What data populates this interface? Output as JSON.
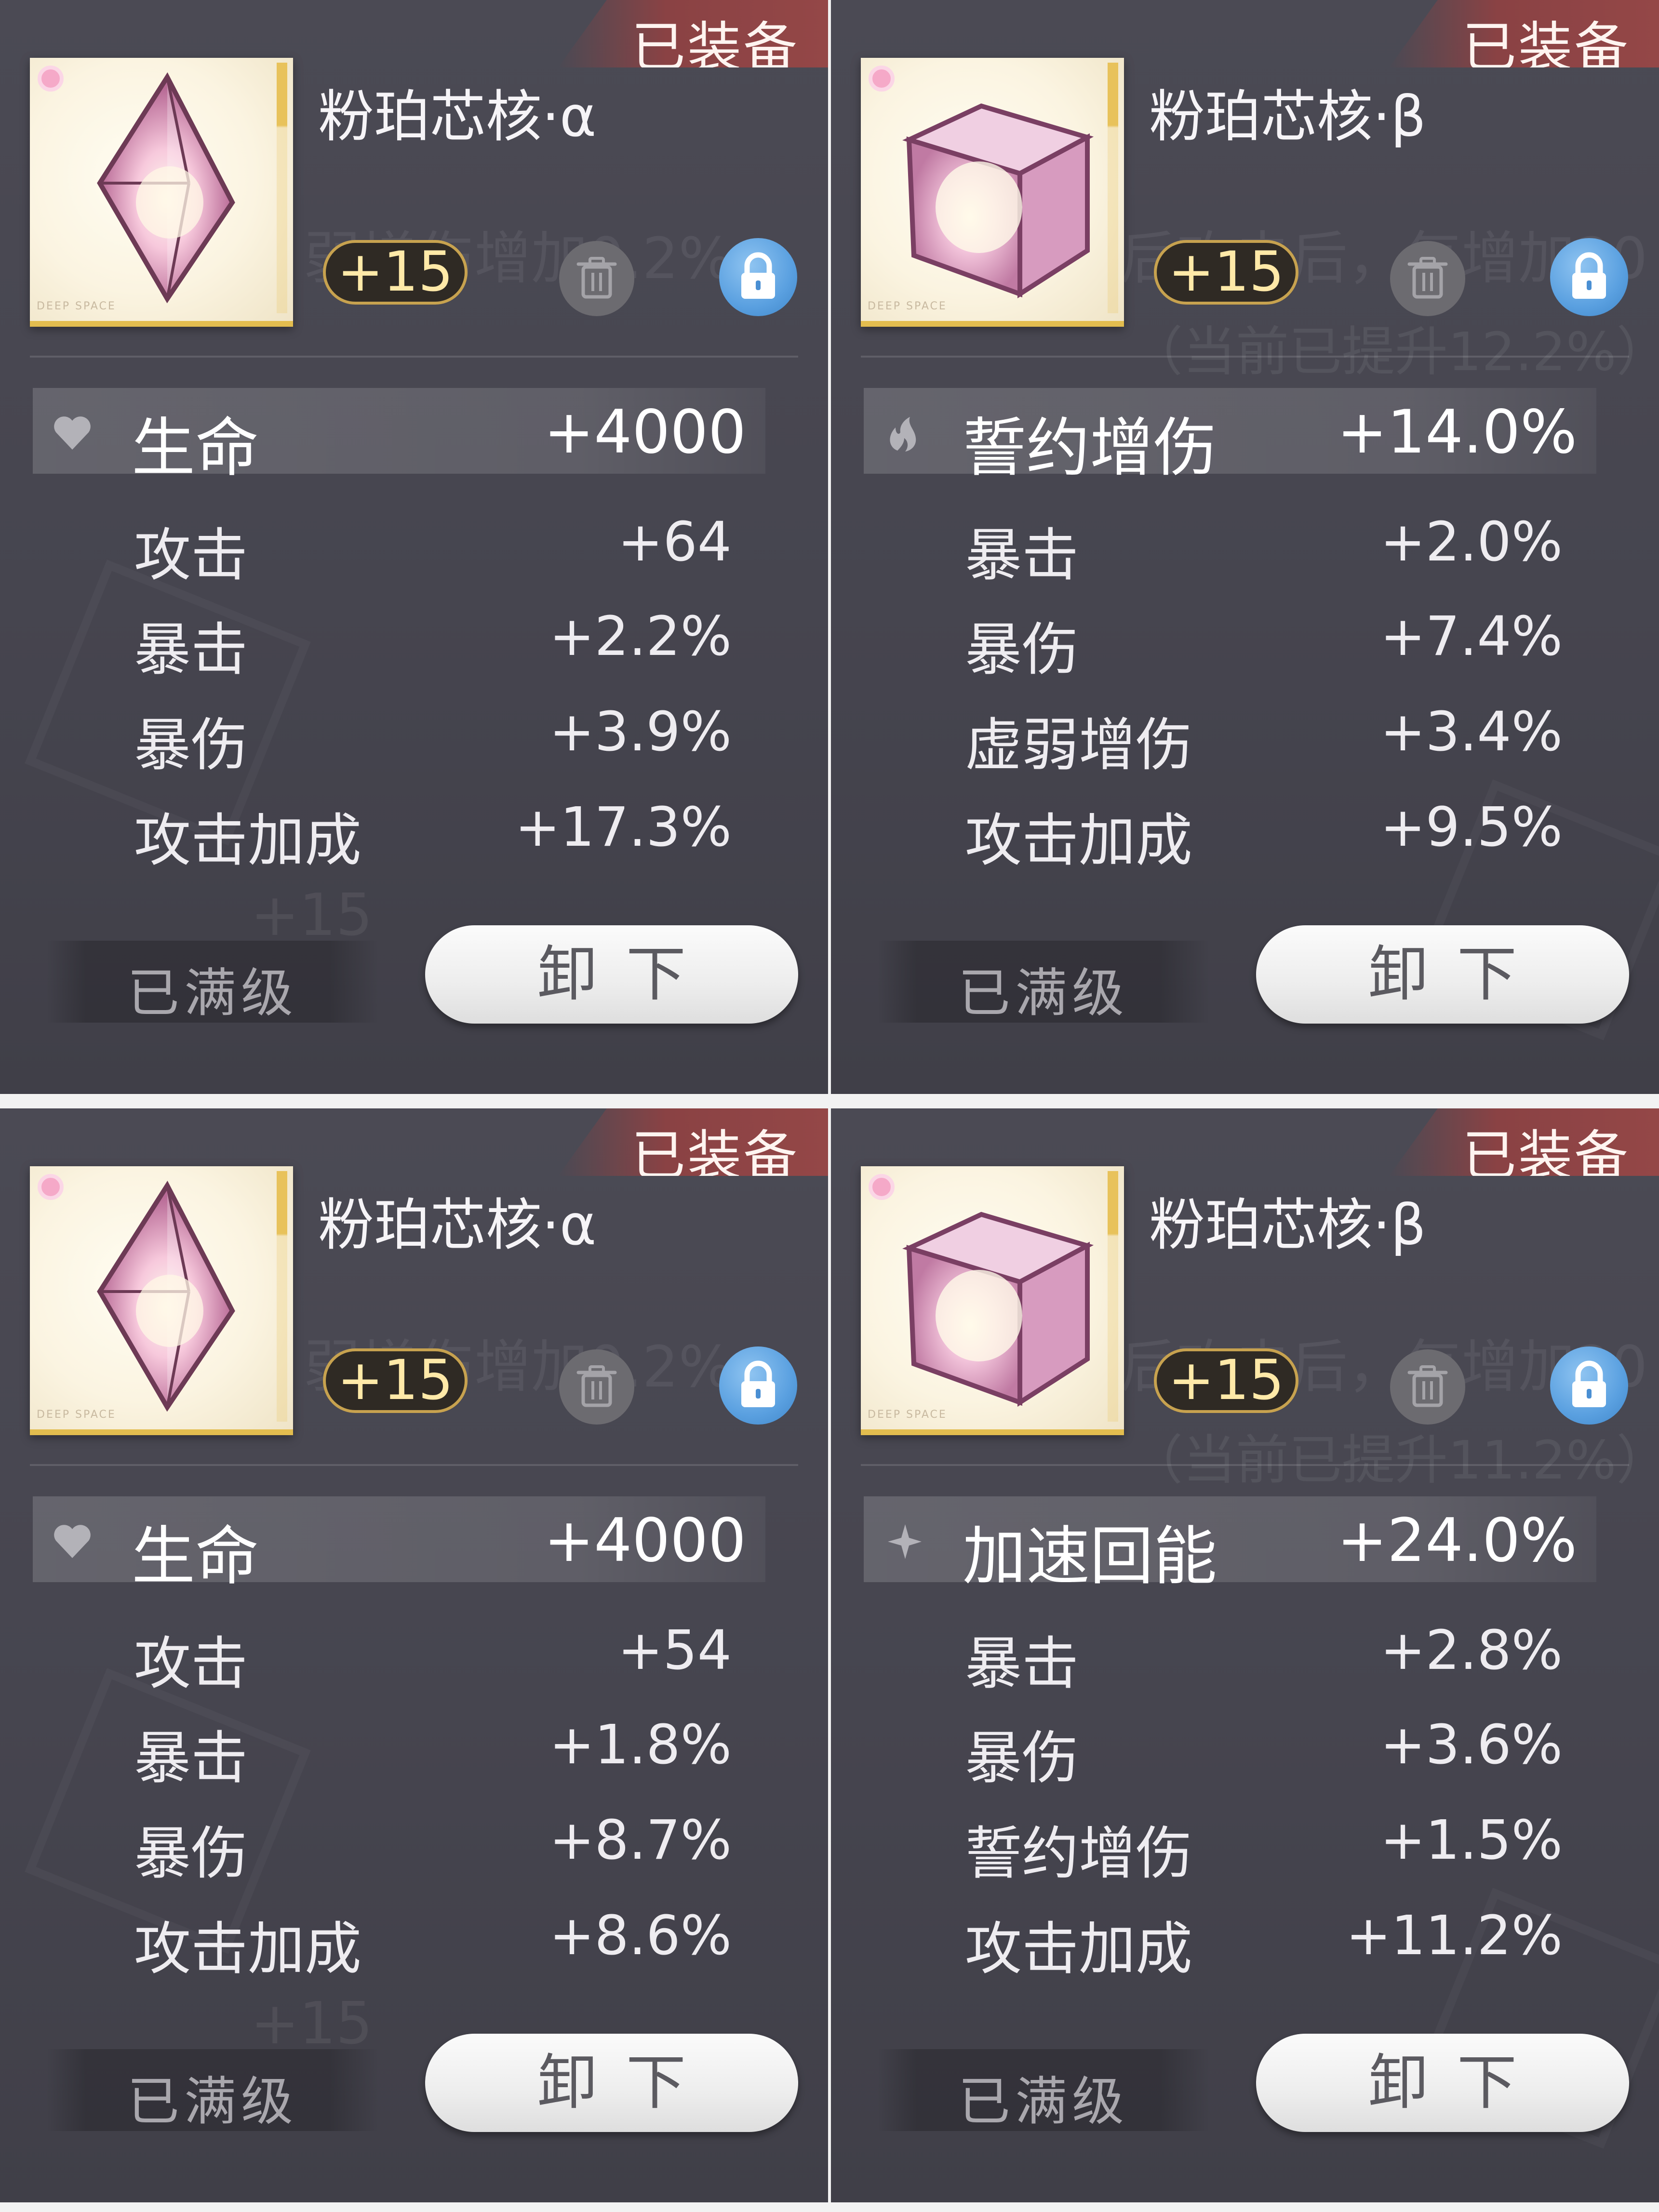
{
  "cards": [
    {
      "equipped_label": "已装备",
      "name": "粉珀芯核·α",
      "level": "+15",
      "gem_shape": "diamond",
      "thumb_label": "DEEP SPACE",
      "main_stat": {
        "icon": "heart-icon",
        "label": "生命",
        "value": "+4000"
      },
      "sub_stats": [
        {
          "label": "攻击",
          "value": "+64"
        },
        {
          "label": "暴击",
          "value": "+2.2%"
        },
        {
          "label": "暴伤",
          "value": "+3.9%"
        },
        {
          "label": "攻击加成",
          "value": "+17.3%"
        }
      ],
      "max_level_label": "已满级",
      "unequip_label": "卸下"
    },
    {
      "equipped_label": "已装备",
      "name": "粉珀芯核·β",
      "level": "+15",
      "gem_shape": "cube",
      "thumb_label": "DEEP SPACE",
      "main_stat": {
        "icon": "flame-icon",
        "label": "誓约增伤",
        "value": "+14.0%"
      },
      "sub_stats": [
        {
          "label": "暴击",
          "value": "+2.0%"
        },
        {
          "label": "暴伤",
          "value": "+7.4%"
        },
        {
          "label": "虚弱增伤",
          "value": "+3.4%"
        },
        {
          "label": "攻击加成",
          "value": "+9.5%"
        }
      ],
      "max_level_label": "已满级",
      "unequip_label": "卸下"
    },
    {
      "equipped_label": "已装备",
      "name": "粉珀芯核·α",
      "level": "+15",
      "gem_shape": "diamond",
      "thumb_label": "DEEP SPACE",
      "main_stat": {
        "icon": "heart-icon",
        "label": "生命",
        "value": "+4000"
      },
      "sub_stats": [
        {
          "label": "攻击",
          "value": "+54"
        },
        {
          "label": "暴击",
          "value": "+1.8%"
        },
        {
          "label": "暴伤",
          "value": "+8.7%"
        },
        {
          "label": "攻击加成",
          "value": "+8.6%"
        }
      ],
      "max_level_label": "已满级",
      "unequip_label": "卸下"
    },
    {
      "equipped_label": "已装备",
      "name": "粉珀芯核·β",
      "level": "+15",
      "gem_shape": "cube",
      "thumb_label": "DEEP SPACE",
      "main_stat": {
        "icon": "sparkle-icon",
        "label": "加速回能",
        "value": "+24.0%"
      },
      "sub_stats": [
        {
          "label": "暴击",
          "value": "+2.8%"
        },
        {
          "label": "暴伤",
          "value": "+3.6%"
        },
        {
          "label": "誓约增伤",
          "value": "+1.5%"
        },
        {
          "label": "攻击加成",
          "value": "+11.2%"
        }
      ],
      "max_level_label": "已满级",
      "unequip_label": "卸下"
    }
  ],
  "background_text": {
    "left_ghost": "弱增伤增加0.2%",
    "right_ghost_1": "后攻击后，每增加20",
    "right_ghost_2a": "（当前已提升12.2%）",
    "right_ghost_2b": "（当前已提升11.2%）",
    "level_ghost": "+15"
  },
  "colors": {
    "card_bg": "#46454f",
    "badge_red": "#8a4244",
    "level_gold": "#c7a24f",
    "lock_blue": "#5aa0e0",
    "button_white": "#f4f4f4"
  }
}
